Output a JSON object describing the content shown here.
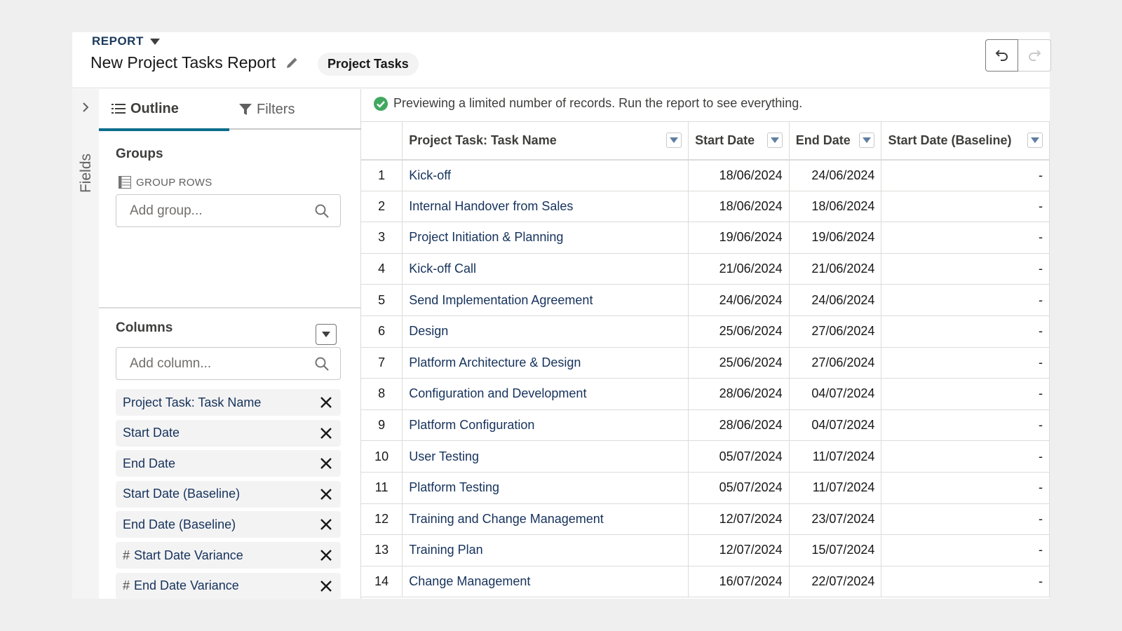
{
  "header": {
    "report_label": "REPORT",
    "report_title": "New Project Tasks Report",
    "object_pill": "Project Tasks"
  },
  "fields_rail": {
    "label": "Fields"
  },
  "panel": {
    "tabs": [
      {
        "label": "Outline",
        "active": true
      },
      {
        "label": "Filters",
        "active": false
      }
    ],
    "groups": {
      "title": "Groups",
      "group_rows_label": "GROUP ROWS",
      "add_group_placeholder": "Add group..."
    },
    "columns": {
      "title": "Columns",
      "add_column_placeholder": "Add column...",
      "items": [
        {
          "label": "Project Task: Task Name",
          "numeric": false
        },
        {
          "label": "Start Date",
          "numeric": false
        },
        {
          "label": "End Date",
          "numeric": false
        },
        {
          "label": "Start Date (Baseline)",
          "numeric": false
        },
        {
          "label": "End Date (Baseline)",
          "numeric": false
        },
        {
          "label": "Start Date Variance",
          "numeric": true
        },
        {
          "label": "End Date Variance",
          "numeric": true
        }
      ],
      "hash_symbol": "#"
    }
  },
  "main": {
    "banner": "Previewing a limited number of records. Run the report to see everything.",
    "table": {
      "headers": [
        "Project Task: Task Name",
        "Start Date",
        "End Date",
        "Start Date (Baseline)"
      ],
      "rows": [
        {
          "n": "1",
          "name": "Kick-off",
          "start": "18/06/2024",
          "end": "24/06/2024",
          "baseline": "-"
        },
        {
          "n": "2",
          "name": "Internal Handover from Sales",
          "start": "18/06/2024",
          "end": "18/06/2024",
          "baseline": "-"
        },
        {
          "n": "3",
          "name": "Project Initiation & Planning",
          "start": "19/06/2024",
          "end": "19/06/2024",
          "baseline": "-"
        },
        {
          "n": "4",
          "name": "Kick-off Call",
          "start": "21/06/2024",
          "end": "21/06/2024",
          "baseline": "-"
        },
        {
          "n": "5",
          "name": "Send Implementation Agreement",
          "start": "24/06/2024",
          "end": "24/06/2024",
          "baseline": "-"
        },
        {
          "n": "6",
          "name": "Design",
          "start": "25/06/2024",
          "end": "27/06/2024",
          "baseline": "-"
        },
        {
          "n": "7",
          "name": "Platform Architecture & Design",
          "start": "25/06/2024",
          "end": "27/06/2024",
          "baseline": "-"
        },
        {
          "n": "8",
          "name": "Configuration and Development",
          "start": "28/06/2024",
          "end": "04/07/2024",
          "baseline": "-"
        },
        {
          "n": "9",
          "name": "Platform Configuration",
          "start": "28/06/2024",
          "end": "04/07/2024",
          "baseline": "-"
        },
        {
          "n": "10",
          "name": "User Testing",
          "start": "05/07/2024",
          "end": "11/07/2024",
          "baseline": "-"
        },
        {
          "n": "11",
          "name": "Platform Testing",
          "start": "05/07/2024",
          "end": "11/07/2024",
          "baseline": "-"
        },
        {
          "n": "12",
          "name": "Training and Change Management",
          "start": "12/07/2024",
          "end": "23/07/2024",
          "baseline": "-"
        },
        {
          "n": "13",
          "name": "Training Plan",
          "start": "12/07/2024",
          "end": "15/07/2024",
          "baseline": "-"
        },
        {
          "n": "14",
          "name": "Change Management",
          "start": "16/07/2024",
          "end": "22/07/2024",
          "baseline": "-"
        }
      ]
    }
  },
  "colors": {
    "accent": "#0b6d8c",
    "success": "#2e844a",
    "link": "#16325c"
  }
}
